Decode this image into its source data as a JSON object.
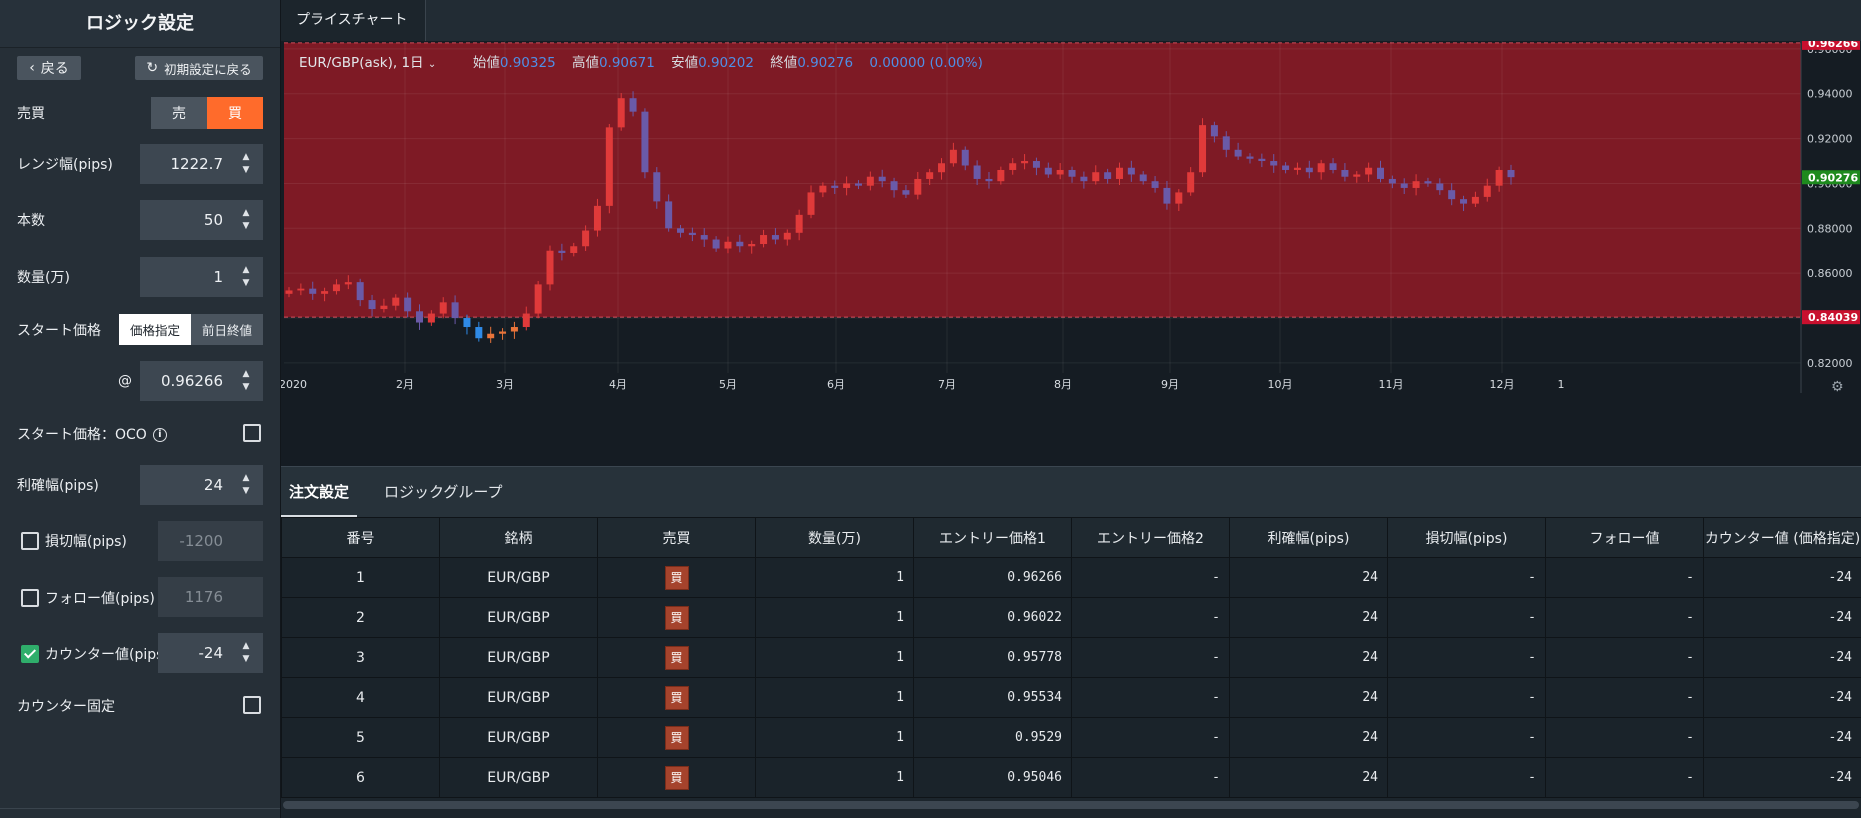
{
  "left": {
    "title": "ロジック設定",
    "back": "戻る",
    "reset": "初期設定に戻る",
    "side_label": "売買",
    "sell": "売",
    "buy": "買",
    "range_label": "レンジ幅(pips)",
    "range_value": "1222.7",
    "count_label": "本数",
    "count_value": "50",
    "qty_label": "数量(万)",
    "qty_value": "1",
    "start_label": "スタート価格",
    "start_opt1": "価格指定",
    "start_opt2": "前日終値",
    "at": "@",
    "start_price": "0.96266",
    "oco_label": "スタート価格：OCO",
    "tp_label": "利確幅(pips)",
    "tp_value": "24",
    "sl_label": "損切幅(pips)",
    "sl_value": "-1200",
    "follow_label": "フォロー値(pips)",
    "follow_value": "1176",
    "counter_label": "カウンター値(pips)",
    "counter_value": "-24",
    "counter_fix_label": "カウンター固定"
  },
  "tabs": {
    "chart_tab": "プライスチャート"
  },
  "chart_header": {
    "symbol": "EUR/GBP(ask), 1日",
    "open_k": "始値",
    "open_v": "0.90325",
    "high_k": "高値",
    "high_v": "0.90671",
    "low_k": "安値",
    "low_v": "0.90202",
    "close_k": "終値",
    "close_v": "0.90276",
    "change": "0.00000 (0.00%)"
  },
  "chart_data": {
    "type": "candlestick",
    "symbol": "EUR/GBP(ask)",
    "timeframe": "1日",
    "x_ticks": [
      "2020",
      "2月",
      "3月",
      "4月",
      "5月",
      "6月",
      "7月",
      "8月",
      "9月",
      "10月",
      "11月",
      "12月",
      "1"
    ],
    "y_ticks": [
      "0.96000",
      "0.94000",
      "0.92000",
      "0.90000",
      "0.88000",
      "0.86000",
      "0.84000",
      "0.82000"
    ],
    "ylim": [
      0.8155,
      0.9635
    ],
    "range_band": {
      "top": 0.96266,
      "bottom": 0.84039,
      "color": "#7e1a25"
    },
    "price_labels": [
      {
        "value": "0.96266",
        "color": "#c8102e"
      },
      {
        "value": "0.90276",
        "color": "#1e8a1e"
      },
      {
        "value": "0.84039",
        "color": "#c8102e"
      }
    ],
    "close_series": [
      0.8523,
      0.8531,
      0.8508,
      0.852,
      0.855,
      0.856,
      0.848,
      0.844,
      0.8455,
      0.8491,
      0.843,
      0.838,
      0.842,
      0.847,
      0.84,
      0.836,
      0.831,
      0.833,
      0.834,
      0.836,
      0.842,
      0.855,
      0.87,
      0.869,
      0.872,
      0.879,
      0.89,
      0.925,
      0.938,
      0.932,
      0.905,
      0.892,
      0.88,
      0.878,
      0.877,
      0.875,
      0.871,
      0.874,
      0.872,
      0.873,
      0.877,
      0.875,
      0.878,
      0.886,
      0.896,
      0.899,
      0.898,
      0.9,
      0.899,
      0.903,
      0.901,
      0.897,
      0.895,
      0.902,
      0.905,
      0.909,
      0.915,
      0.908,
      0.902,
      0.901,
      0.906,
      0.909,
      0.91,
      0.907,
      0.904,
      0.906,
      0.903,
      0.901,
      0.905,
      0.902,
      0.907,
      0.904,
      0.901,
      0.898,
      0.891,
      0.896,
      0.905,
      0.926,
      0.921,
      0.915,
      0.912,
      0.911,
      0.91,
      0.908,
      0.906,
      0.907,
      0.905,
      0.909,
      0.906,
      0.903,
      0.904,
      0.907,
      0.902,
      0.9,
      0.898,
      0.901,
      0.9,
      0.897,
      0.893,
      0.891,
      0.894,
      0.899,
      0.906,
      0.9028
    ]
  },
  "order_tabs": {
    "tab1": "注文設定",
    "tab2": "ロジックグループ"
  },
  "order_table": {
    "headers": [
      "番号",
      "銘柄",
      "売買",
      "数量(万)",
      "エントリー価格1",
      "エントリー価格2",
      "利確幅(pips)",
      "損切幅(pips)",
      "フォロー値",
      "カウンター値 (価格指定)"
    ],
    "rows": [
      [
        "1",
        "EUR/GBP",
        "買",
        "1",
        "0.96266",
        "-",
        "24",
        "-",
        "-",
        "-24"
      ],
      [
        "2",
        "EUR/GBP",
        "買",
        "1",
        "0.96022",
        "-",
        "24",
        "-",
        "-",
        "-24"
      ],
      [
        "3",
        "EUR/GBP",
        "買",
        "1",
        "0.95778",
        "-",
        "24",
        "-",
        "-",
        "-24"
      ],
      [
        "4",
        "EUR/GBP",
        "買",
        "1",
        "0.95534",
        "-",
        "24",
        "-",
        "-",
        "-24"
      ],
      [
        "5",
        "EUR/GBP",
        "買",
        "1",
        "0.9529",
        "-",
        "24",
        "-",
        "-",
        "-24"
      ],
      [
        "6",
        "EUR/GBP",
        "買",
        "1",
        "0.95046",
        "-",
        "24",
        "-",
        "-",
        "-24"
      ]
    ]
  },
  "colors": {
    "buy_accent": "#ff6b2b",
    "buy_badge": "#a5432c",
    "checkbox_checked": "#2fae6b",
    "range_band": "#7e1a25",
    "candle_up": "#e03a3a",
    "candle_down": "#6a5aa8",
    "candle_below_up": "#e9743a",
    "candle_below_down": "#2f8ae6"
  }
}
